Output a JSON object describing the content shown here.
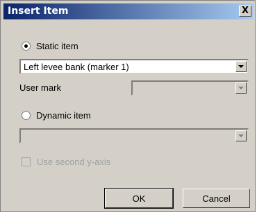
{
  "window": {
    "title": "Insert Item",
    "close_label": "X"
  },
  "static_item": {
    "label": "Static item",
    "checked": true,
    "selected_value": "Left levee bank (marker 1)"
  },
  "user_mark": {
    "label": "User mark",
    "value": ""
  },
  "dynamic_item": {
    "label": "Dynamic item",
    "checked": false,
    "value": ""
  },
  "second_axis": {
    "label": "Use second y-axis",
    "checked": false,
    "enabled": false
  },
  "buttons": {
    "ok": "OK",
    "cancel": "Cancel"
  }
}
